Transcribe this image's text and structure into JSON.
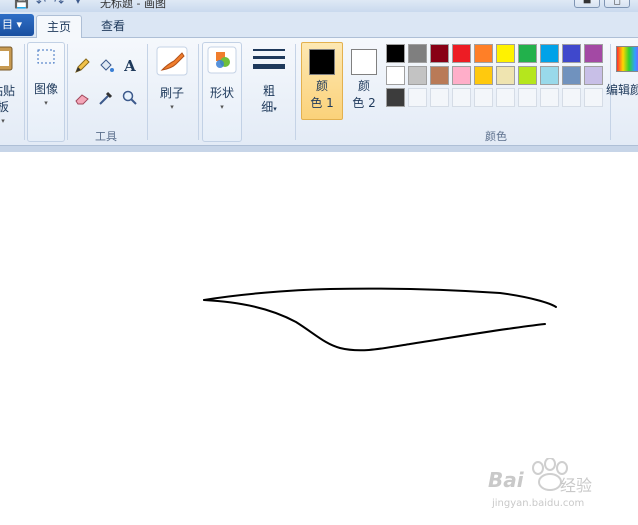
{
  "window": {
    "title": "无标题 - 画图"
  },
  "app_menu": {
    "label": "目 ▾"
  },
  "tabs": [
    {
      "label": "主页",
      "active": true
    },
    {
      "label": "查看",
      "active": false
    }
  ],
  "ribbon": {
    "clipboard": {
      "label": "粘贴板"
    },
    "image": {
      "label": "图像"
    },
    "tools": {
      "label": "工具",
      "text_tool": "A"
    },
    "brushes": {
      "label": "刷子"
    },
    "shapes": {
      "label": "形状"
    },
    "size": {
      "line1": "粗",
      "line2": "细"
    },
    "color1": {
      "line1": "颜",
      "line2": "色 1",
      "color": "#000000"
    },
    "color2": {
      "line1": "颜",
      "line2": "色 2",
      "color": "#ffffff"
    },
    "colors_group": {
      "label": "颜色"
    },
    "edit_colors": {
      "label": "编辑颜"
    }
  },
  "palette": [
    [
      "#000000",
      "#7f7f7f",
      "#880015",
      "#ed1c24",
      "#ff7f27",
      "#fff200",
      "#22b14c",
      "#00a2e8",
      "#3f48cc",
      "#a349a4"
    ],
    [
      "#ffffff",
      "#c3c3c3",
      "#b97a57",
      "#ffaec9",
      "#ffc90e",
      "#efe4b0",
      "#b5e61d",
      "#99d9ea",
      "#7092be",
      "#c8bfe7"
    ],
    [
      "#3c3c3c",
      "",
      "",
      "",
      "",
      "",
      "",
      "",
      "",
      ""
    ]
  ],
  "watermark": {
    "brand": "Bai",
    "brand2": "经验",
    "url": "jingyan.baidu.com"
  }
}
